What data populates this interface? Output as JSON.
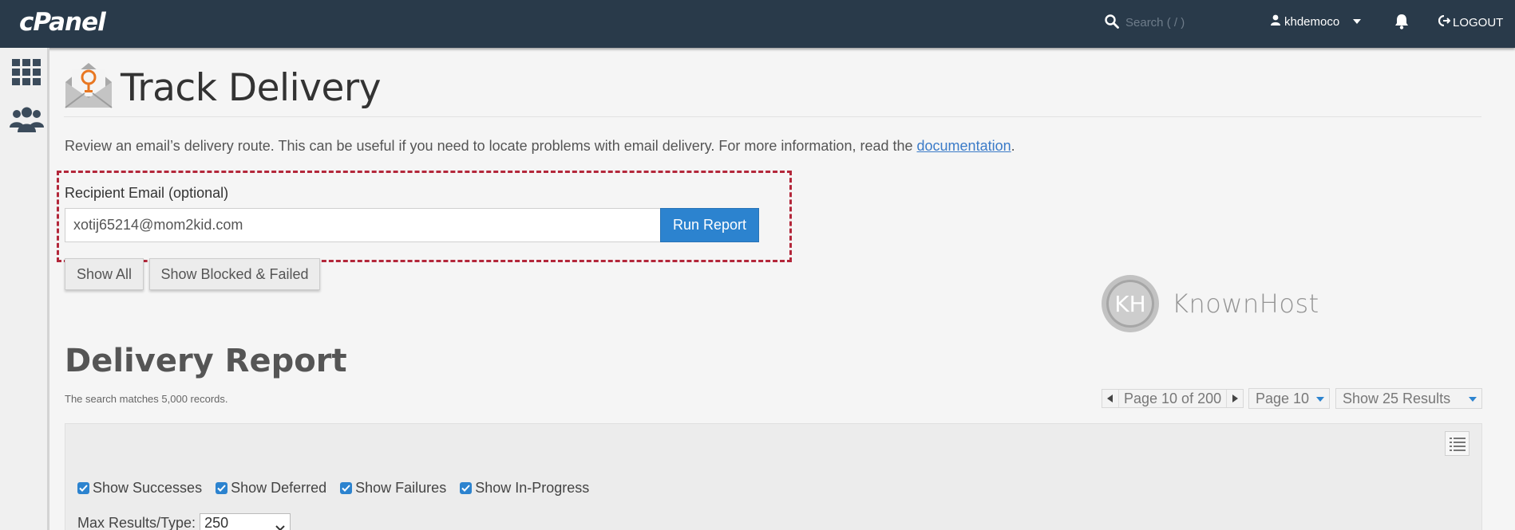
{
  "topbar": {
    "logo": "cPanel",
    "search_placeholder": "Search ( / )",
    "username": "khdemoco",
    "logout_label": "LOGOUT"
  },
  "page": {
    "title": "Track Delivery",
    "description_prefix": "Review an email’s delivery route. This can be useful if you need to locate problems with email delivery. For more information, read the ",
    "description_link": "documentation",
    "description_suffix": "."
  },
  "form": {
    "recipient_label": "Recipient Email (optional)",
    "recipient_value": "xotij65214@mom2kid.com",
    "run_report_label": "Run Report",
    "show_all_label": "Show All",
    "show_blocked_label": "Show Blocked & Failed"
  },
  "watermark": {
    "monogram": "KH",
    "text": "KnownHost"
  },
  "report": {
    "title": "Delivery Report",
    "match_count": "The search matches 5,000 records.",
    "pager_label": "Page 10 of 200",
    "page_select": "Page 10",
    "results_select": "Show 25 Results"
  },
  "filters": {
    "show_successes": "Show Successes",
    "show_deferred": "Show Deferred",
    "show_failures": "Show Failures",
    "show_in_progress": "Show In-Progress",
    "max_results_label": "Max Results/Type:",
    "max_results_value": "250"
  },
  "icons": {
    "search": "search-icon",
    "user": "user-icon",
    "bell": "bell-icon",
    "logout": "logout-icon",
    "grid": "grid-icon",
    "users": "users-icon",
    "track": "mail-location-icon",
    "columns": "columns-icon"
  },
  "colors": {
    "topbar": "#293a4a",
    "primary": "#2c83cf",
    "highlight": "#b3273a",
    "marker": "#e87722"
  }
}
